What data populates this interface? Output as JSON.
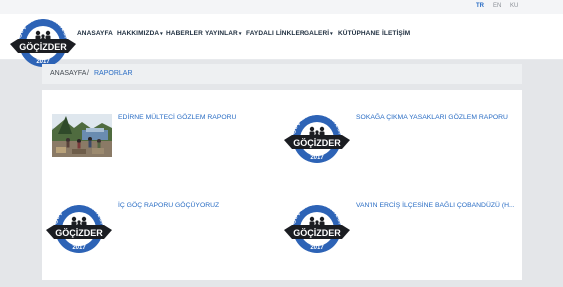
{
  "languages": [
    {
      "code": "TR",
      "active": true
    },
    {
      "code": "EN",
      "active": false
    },
    {
      "code": "KU",
      "active": false
    }
  ],
  "logo": {
    "arc_text": "GÖÇ İZLEME DERNEĞİ",
    "name": "GÖÇİZDER",
    "year": "2017"
  },
  "nav": {
    "items": [
      {
        "label": "ANASAYFA",
        "dropdown": false
      },
      {
        "label": "HAKKIMIZDA",
        "dropdown": true
      },
      {
        "label": "HABERLER",
        "dropdown": false
      },
      {
        "label": "YAYINLAR",
        "dropdown": true
      },
      {
        "label": "FAYDALI LİNKLER",
        "dropdown": false
      },
      {
        "label": "GALERİ",
        "dropdown": true
      },
      {
        "label": "KÜTÜPHANE",
        "dropdown": false
      },
      {
        "label": "İLETİŞİM",
        "dropdown": false
      }
    ],
    "caret": "▾"
  },
  "breadcrumb": {
    "home": "ANASAYFA",
    "separator": "/",
    "current": "RAPORLAR"
  },
  "reports": [
    {
      "title": "EDİRNE MÜLTECİ GÖZLEM RAPORU",
      "thumbnail": "photo"
    },
    {
      "title": "SOKAĞA ÇIKMA YASAKLARI GÖZLEM RAPORU",
      "thumbnail": "logo"
    },
    {
      "title": "İÇ GÖÇ RAPORU GÖÇÜYORUZ",
      "thumbnail": "logo"
    },
    {
      "title": "VAN'IN ERCİŞ İLÇESİNE BAĞLI ÇOBANDÜZÜ (H...",
      "thumbnail": "logo"
    }
  ],
  "colors": {
    "accent": "#2a6dc4",
    "logo_blue": "#2d63b6",
    "logo_dark": "#1b1d22",
    "nav_text": "#1d2d3e",
    "background": "#e4e6e9"
  }
}
